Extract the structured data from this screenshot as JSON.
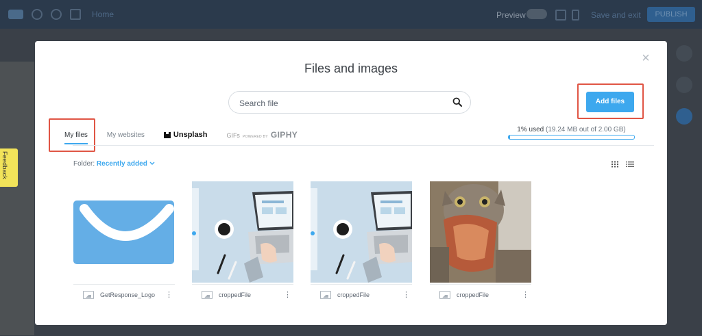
{
  "editor": {
    "pages_label": "Home",
    "preview_label": "Preview",
    "save_label": "Save and exit",
    "publish_label": "PUBLISH"
  },
  "feedback": {
    "label": "Feedback"
  },
  "modal": {
    "title": "Files and images",
    "close_label": "×",
    "search": {
      "placeholder": "Search file",
      "value": ""
    },
    "add_files_label": "Add files",
    "tabs": [
      {
        "label": "My files",
        "active": true
      },
      {
        "label": "My websites",
        "active": false
      },
      {
        "label": "Unsplash",
        "active": false
      },
      {
        "label": "GIFs",
        "powered": "POWERED BY",
        "brand": "GIPHY",
        "active": false
      }
    ],
    "storage": {
      "used_label": "1% used",
      "detail": "(19.24 MB out of 2.00 GB)",
      "percent": 1
    },
    "folder": {
      "label": "Folder:",
      "value": "Recently added"
    },
    "files": [
      {
        "name": "GetResponse_Logo",
        "kind": "logo-icon"
      },
      {
        "name": "croppedFile",
        "kind": "laptop-photo"
      },
      {
        "name": "croppedFile",
        "kind": "laptop-photo"
      },
      {
        "name": "croppedFile",
        "kind": "cat-photo"
      }
    ]
  },
  "colors": {
    "accent": "#3da8ee",
    "highlight": "#e05544",
    "feedback": "#f2e35a",
    "overlay": "#3a4048"
  }
}
